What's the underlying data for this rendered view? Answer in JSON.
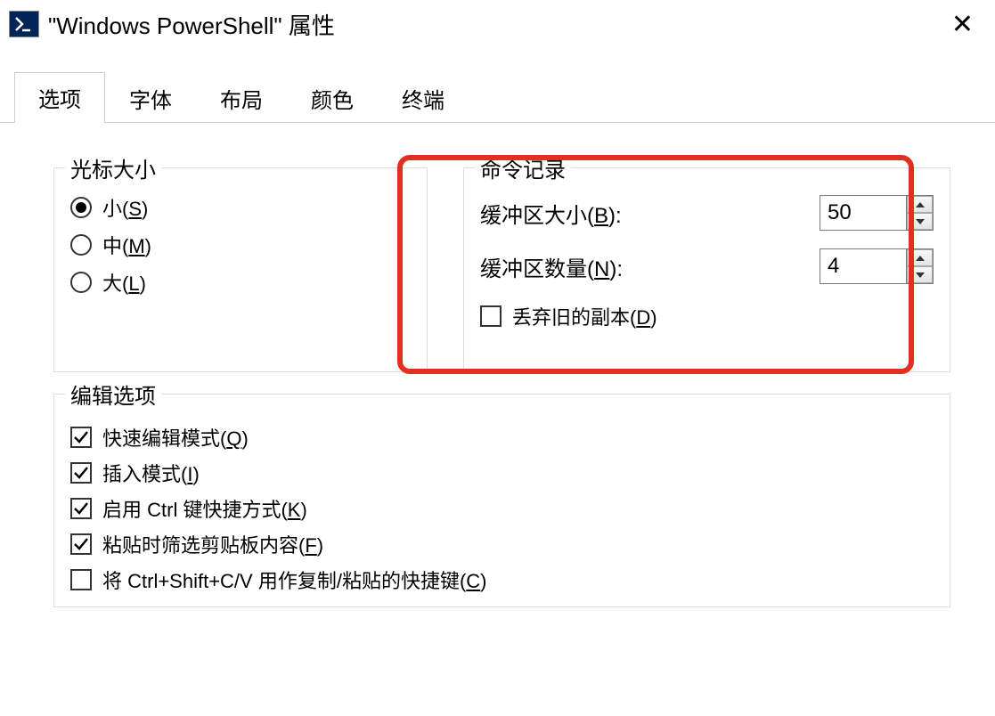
{
  "titlebar": {
    "title": "\"Windows PowerShell\" 属性"
  },
  "tabs": [
    {
      "label": "选项",
      "active": true
    },
    {
      "label": "字体",
      "active": false
    },
    {
      "label": "布局",
      "active": false
    },
    {
      "label": "颜色",
      "active": false
    },
    {
      "label": "终端",
      "active": false
    }
  ],
  "cursor": {
    "legend": "光标大小",
    "small_prefix": "小(",
    "small_key": "S",
    "small_suffix": ")",
    "medium_prefix": "中(",
    "medium_key": "M",
    "medium_suffix": ")",
    "large_prefix": "大(",
    "large_key": "L",
    "large_suffix": ")"
  },
  "cmd": {
    "legend": "命令记录",
    "buffer_size_prefix": "缓冲区大小(",
    "buffer_size_key": "B",
    "buffer_size_suffix": "):",
    "buffer_size_value": "50",
    "buffer_count_prefix": "缓冲区数量(",
    "buffer_count_key": "N",
    "buffer_count_suffix": "):",
    "buffer_count_value": "4",
    "discard_prefix": "丢弃旧的副本(",
    "discard_key": "D",
    "discard_suffix": ")"
  },
  "edit": {
    "legend": "编辑选项",
    "quick_prefix": "快速编辑模式(",
    "quick_key": "Q",
    "quick_suffix": ")",
    "insert_prefix": "插入模式(",
    "insert_key": "I",
    "insert_suffix": ")",
    "ctrl_prefix": "启用 Ctrl 键快捷方式(",
    "ctrl_key": "K",
    "ctrl_suffix": ")",
    "filter_prefix": "粘贴时筛选剪贴板内容(",
    "filter_key": "F",
    "filter_suffix": ")",
    "copy_prefix": "将 Ctrl+Shift+C/V 用作复制/粘贴的快捷键(",
    "copy_key": "C",
    "copy_suffix": ")"
  }
}
